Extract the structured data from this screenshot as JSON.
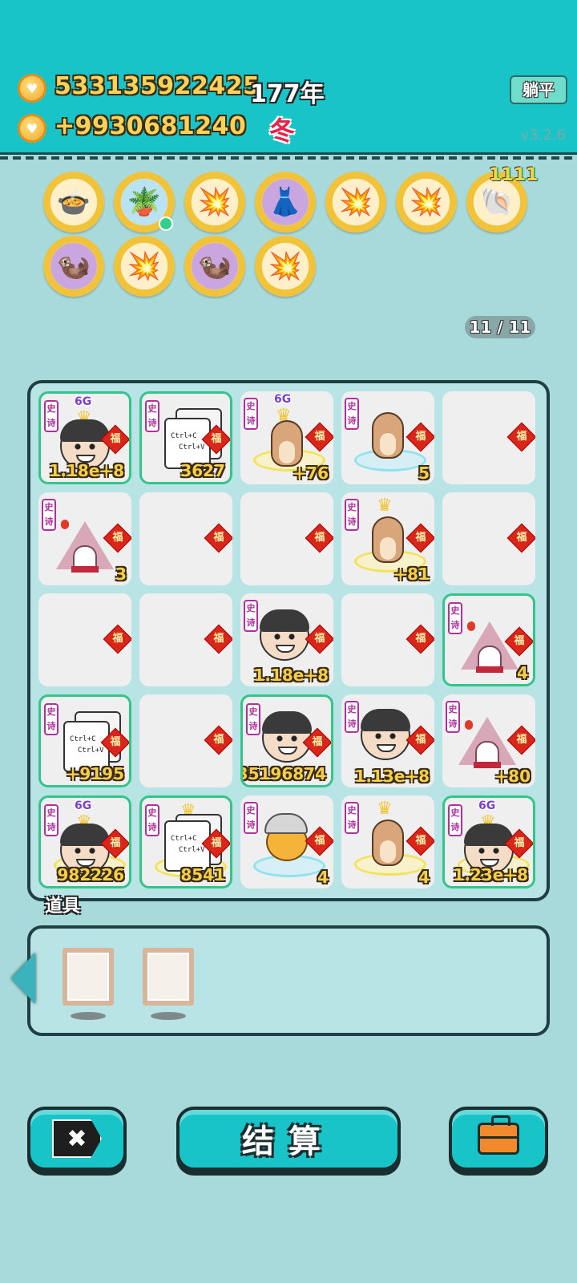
{
  "header": {
    "money": "533135922425",
    "income": "+9930681240",
    "year": "177年",
    "season": "冬",
    "flat_button": "躺平",
    "version": "v3.2.6"
  },
  "badges": [
    {
      "icon": "rice-cooker-icon",
      "glyph": "🍲",
      "bg": "cream"
    },
    {
      "icon": "potted-flower-icon",
      "glyph": "🪴",
      "bg": "blue",
      "dot": true
    },
    {
      "icon": "mushroom-cloud-icon",
      "glyph": "💥",
      "bg": "cream"
    },
    {
      "icon": "skirt-icon",
      "glyph": "👗",
      "bg": "purple"
    },
    {
      "icon": "mushroom-cloud-icon",
      "glyph": "💥",
      "bg": "cream"
    },
    {
      "icon": "mushroom-cloud-icon",
      "glyph": "💥",
      "bg": "cream"
    },
    {
      "icon": "seashell-icon",
      "glyph": "🐚",
      "bg": "cream"
    },
    {
      "icon": "otter-family-icon",
      "glyph": "🦦",
      "bg": "purple"
    },
    {
      "icon": "mushroom-cloud-icon",
      "glyph": "💥",
      "bg": "cream"
    },
    {
      "icon": "otter-family-icon",
      "glyph": "🦦",
      "bg": "purple"
    },
    {
      "icon": "mushroom-cloud-icon",
      "glyph": "💥",
      "bg": "cream"
    }
  ],
  "badge_stack": "1111",
  "page_count": "11 / 11",
  "board": {
    "fu": "福",
    "poem_tag": "史诗",
    "ctrl_c": "Ctrl+C",
    "ctrl_v": "Ctrl+V",
    "sixg": "6G",
    "values": {
      "r0c0": "1.18e+8",
      "r0c1": "3627",
      "r0c2": "+76",
      "r0c3": "5",
      "r1c0": "3",
      "r1c3": "+81",
      "r2c2": "1.18e+8",
      "r2c4": "4",
      "r3c0": "+9195",
      "r3c2": "35196874",
      "r3c3": "1.13e+8",
      "r3c4": "+80",
      "r4c0": "982226",
      "r4c1": "8541",
      "r4c2": "4",
      "r4c3": "4",
      "r4c4": "1.23e+8"
    }
  },
  "tools": {
    "label": "道具"
  },
  "bottom": {
    "close_glyph": "✖",
    "settle_label": "结算"
  }
}
